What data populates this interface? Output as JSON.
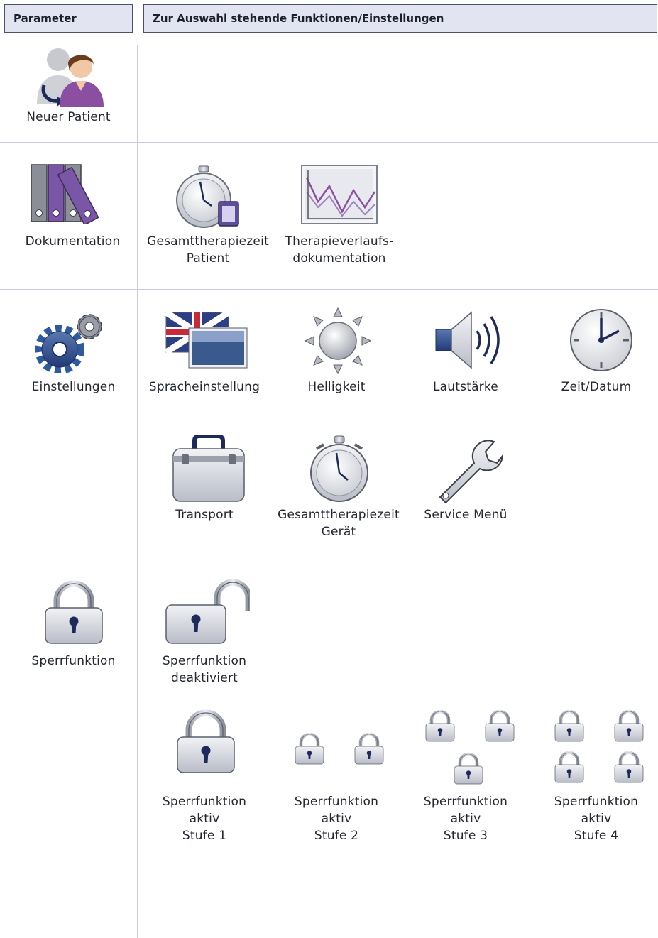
{
  "header": {
    "parameter": "Parameter",
    "functions": "Zur Auswahl stehende Funktionen/Einstellungen"
  },
  "sections": {
    "new_patient": {
      "label": "Neuer Patient",
      "icon": "new-patient-icon"
    },
    "documentation": {
      "label": "Dokumentation",
      "icon": "binders-icon",
      "items": [
        {
          "label": "Gesamttherapiezeit\nPatient",
          "icon": "stopwatch-card-icon"
        },
        {
          "label": "Therapieverlaufs-\ndokumentation",
          "icon": "chart-icon"
        }
      ]
    },
    "settings": {
      "label": "Einstellungen",
      "icon": "gears-icon",
      "items": [
        {
          "label": "Spracheinstellung",
          "icon": "flags-icon"
        },
        {
          "label": "Helligkeit",
          "icon": "sun-icon"
        },
        {
          "label": "Lautstärke",
          "icon": "speaker-icon"
        },
        {
          "label": "Zeit/Datum",
          "icon": "clock-icon"
        },
        {
          "label": "Transport",
          "icon": "suitcase-icon"
        },
        {
          "label": "Gesamttherapiezeit\nGerät",
          "icon": "stopwatch-icon"
        },
        {
          "label": "Service Menü",
          "icon": "wrench-icon"
        }
      ]
    },
    "lock": {
      "label": "Sperrfunktion",
      "icon": "padlock-icon",
      "items": [
        {
          "label": "Sperrfunktion\ndeaktiviert",
          "icon": "padlock-open-icon"
        },
        {
          "label": "Sperrfunktion\naktiv\nStufe 1",
          "icon": "padlock-icon"
        },
        {
          "label": "Sperrfunktion\naktiv\nStufe 2",
          "icon": "padlocks-2-icon"
        },
        {
          "label": "Sperrfunktion\naktiv\nStufe 3",
          "icon": "padlocks-3-icon"
        },
        {
          "label": "Sperrfunktion\naktiv\nStufe 4",
          "icon": "padlocks-4-icon"
        }
      ]
    }
  },
  "colors": {
    "header_bg": "#e2e5f1",
    "header_border": "#4b4f70",
    "divider": "#c9cce0",
    "accent_navy": "#1f2a5c",
    "accent_purple": "#8a4fa0"
  }
}
